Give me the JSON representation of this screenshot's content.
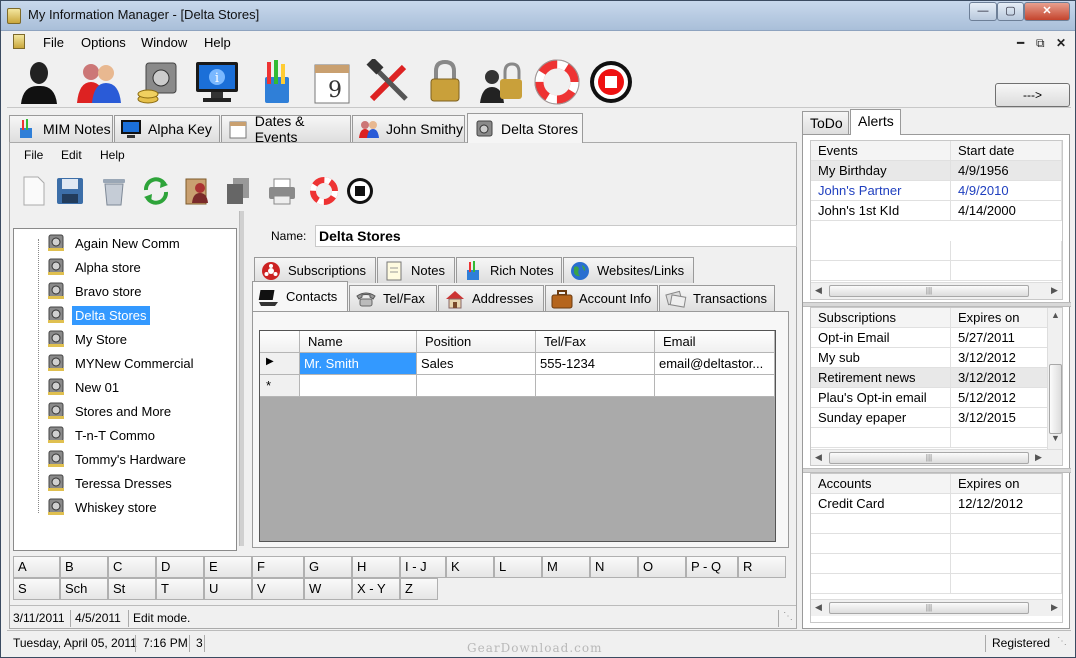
{
  "window": {
    "title": "My Information Manager - [Delta Stores]"
  },
  "menu": {
    "items": [
      "File",
      "Options",
      "Window",
      "Help"
    ]
  },
  "toolbar_icons": [
    "person-icon",
    "people-icon",
    "safe-money-icon",
    "info-monitor-icon",
    "pencils-icon",
    "calendar-icon",
    "tools-icon",
    "padlock-icon",
    "user-lock-icon",
    "lifebuoy-icon",
    "stop-icon"
  ],
  "arrow_button": "--->",
  "tabs": [
    {
      "label": "MIM Notes",
      "icon": "pencils-icon"
    },
    {
      "label": "Alpha Key",
      "icon": "info-monitor-icon"
    },
    {
      "label": "Dates & Events",
      "icon": "calendar-icon"
    },
    {
      "label": "John Smithy",
      "icon": "people-icon"
    },
    {
      "label": "Delta Stores",
      "icon": "safe-icon"
    }
  ],
  "inner_menu": {
    "items": [
      "File",
      "Edit",
      "Help"
    ]
  },
  "inner_toolbar_icons": [
    "new-document-icon",
    "save-icon",
    "trash-icon",
    "refresh-icon",
    "address-book-icon",
    "copy-icon",
    "printer-icon",
    "lifebuoy-icon",
    "stop-icon"
  ],
  "tree": {
    "items": [
      "Again New Comm",
      "Alpha store",
      "Bravo store",
      "Delta Stores",
      "My Store",
      "MYNew Commercial",
      "New 01",
      "Stores and More",
      "T-n-T Commo",
      "Tommy's Hardware",
      "Teressa Dresses",
      "Whiskey store"
    ],
    "selected": "Delta Stores"
  },
  "name_field": {
    "label": "Name:",
    "value": "Delta Stores"
  },
  "detail_tabs_row1": [
    {
      "label": "Subscriptions",
      "icon": "biohazard-icon"
    },
    {
      "label": "Notes",
      "icon": "notepad-icon"
    },
    {
      "label": "Rich Notes",
      "icon": "pencils-icon"
    },
    {
      "label": "Websites/Links",
      "icon": "globe-icon"
    }
  ],
  "detail_tabs_row2": [
    {
      "label": "Contacts",
      "icon": "laptop-icon"
    },
    {
      "label": "Tel/Fax",
      "icon": "telephone-icon"
    },
    {
      "label": "Addresses",
      "icon": "house-icon"
    },
    {
      "label": "Account Info",
      "icon": "briefcase-icon"
    },
    {
      "label": "Transactions",
      "icon": "transactions-icon"
    }
  ],
  "contacts_grid": {
    "columns": [
      "Name",
      "Position",
      "Tel/Fax",
      "Email"
    ],
    "rows": [
      [
        "Mr. Smith",
        "Sales",
        "555-1234",
        "email@deltastor..."
      ]
    ],
    "new_row_marker": "*"
  },
  "alpha_row1": [
    "A",
    "B",
    "C",
    "D",
    "E",
    "F",
    "G",
    "H",
    "I - J",
    "K",
    "L",
    "M",
    "N",
    "O",
    "P - Q",
    "R"
  ],
  "alpha_row2": [
    "S",
    "Sch",
    "St",
    "T",
    "U",
    "V",
    "W",
    "X - Y",
    "Z"
  ],
  "status_inner": {
    "date1": "3/11/2011",
    "date2": "4/5/2011",
    "mode": "Edit mode."
  },
  "status_main": {
    "date": "Tuesday, April 05, 2011",
    "time": "7:16 PM",
    "count": "3",
    "registration": "Registered"
  },
  "watermark": "GearDownload.com",
  "right_tabs": [
    "ToDo",
    "Alerts"
  ],
  "events": {
    "columns": [
      "Events",
      "Start date"
    ],
    "rows": [
      [
        "My Birthday",
        "4/9/1956"
      ],
      [
        "John's Partner",
        "4/9/2010"
      ],
      [
        "John's 1st KId",
        "4/14/2000"
      ]
    ]
  },
  "subscriptions": {
    "columns": [
      "Subscriptions",
      "Expires on"
    ],
    "rows": [
      [
        "Opt-in Email",
        "5/27/2011"
      ],
      [
        "My sub",
        "3/12/2012"
      ],
      [
        "Retirement news",
        "3/12/2012"
      ],
      [
        "Plau's Opt-in email",
        "5/12/2012"
      ],
      [
        "Sunday epaper",
        "3/12/2015"
      ]
    ]
  },
  "accounts": {
    "columns": [
      "Accounts",
      "Expires on"
    ],
    "rows": [
      [
        "Credit Card",
        "12/12/2012"
      ]
    ]
  },
  "colors": {
    "selection": "#3399ff",
    "link_row": "#1f3fbf"
  }
}
